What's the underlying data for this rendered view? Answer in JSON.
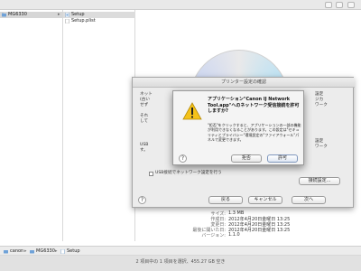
{
  "browser": {
    "column1": {
      "selected": "MG6330"
    },
    "column2": {
      "items": [
        "Setup",
        "Setup.plist"
      ]
    }
  },
  "metadata": {
    "rows": [
      {
        "k": "サイズ:",
        "v": "1.3 MB"
      },
      {
        "k": "作成日:",
        "v": "2012年4月20日金曜日 13:25"
      },
      {
        "k": "変更日:",
        "v": "2012年4月20日金曜日 13:25"
      },
      {
        "k": "最後に開いた日:",
        "v": "2012年4月20日金曜日 13:25"
      },
      {
        "k": "バージョン:",
        "v": "1.1.0"
      }
    ]
  },
  "sheet": {
    "title": "プリンター設定の確認",
    "side_text": [
      "ネット",
      "(古い",
      "せず",
      "それ",
      "して",
      "USB",
      "す。"
    ],
    "right_side_text": [
      "設定",
      "ジカ",
      "ワーク",
      "設定",
      "ワーク"
    ],
    "checkbox_label": "USB接続でネットワーク設定を行う",
    "details_button": "接続設定...",
    "buttons": {
      "back": "戻る",
      "cancel": "キャンセル",
      "next": "次へ"
    }
  },
  "alert": {
    "title": "アプリケーション\"Canon IJ Network Tool.app\"へのネットワーク受信接続を許可しますか?",
    "body": "\"拒否\"をクリックすると、アプリケーションの一部の機能が利用できなくなることがあります。この設定は\"セキュリティとプライバシー\"環境設定の\"ファイアウォール\"パネルで変更できます。",
    "buttons": {
      "deny": "拒否",
      "allow": "許可"
    }
  },
  "pathbar": {
    "items": [
      "canon",
      "MG6330",
      "Setup"
    ]
  },
  "status": {
    "text": "2 項目中の 1 項目を選択、455.27 GB 空き"
  },
  "colors": {
    "warning_yellow": "#f4c21a",
    "folder_blue": "#6fa2d8"
  },
  "icons": [
    "folder-icon",
    "file-icon",
    "warning-icon",
    "help-icon",
    "chevron-right-icon",
    "disk-icon"
  ]
}
